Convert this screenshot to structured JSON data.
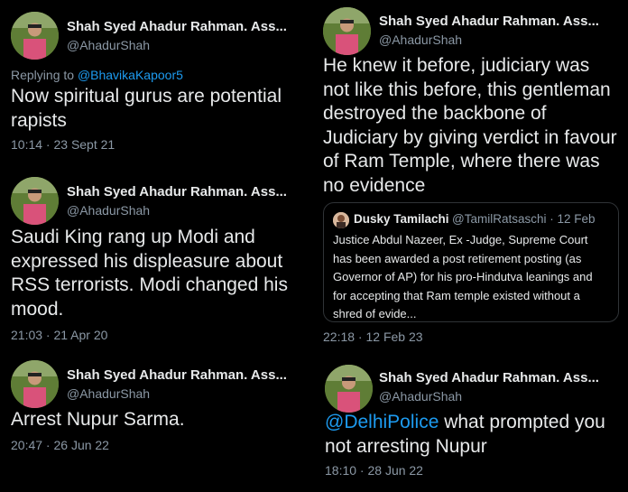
{
  "tweets": [
    {
      "name": "Shah Syed Ahadur Rahman. Ass...",
      "handle": "@AhadurShah",
      "replying_prefix": "Replying to ",
      "replying_to": "@BhavikaKapoor5",
      "text": "Now spiritual gurus are potential rapists",
      "time": "10:14 · 23 Sept 21"
    },
    {
      "name": "Shah Syed Ahadur Rahman. Ass...",
      "handle": "@AhadurShah",
      "text": "Saudi King rang up Modi and expressed his displeasure about RSS terrorists. Modi changed his mood.",
      "time": "21:03 · 21 Apr 20"
    },
    {
      "name": "Shah Syed Ahadur Rahman. Ass...",
      "handle": "@AhadurShah",
      "text": "Arrest Nupur Sarma.",
      "time": "20:47 · 26 Jun 22"
    },
    {
      "name": "Shah Syed Ahadur Rahman. Ass...",
      "handle": "@AhadurShah",
      "text": "He knew it before, judiciary was not like this before, this gentleman destroyed the backbone of Judiciary by giving verdict in favour of Ram Temple, where there was no evidence",
      "quote": {
        "name": "Dusky Tamilachi",
        "handle": "@TamilRatsaschi",
        "date": "· 12 Feb",
        "text": "Justice Abdul Nazeer, Ex -Judge, Supreme Court has been awarded a post retirement posting (as Governor of AP) for his pro-Hindutva leanings and for accepting that Ram temple existed without a shred of evide..."
      },
      "time": "22:18 · 12 Feb 23"
    },
    {
      "name": "Shah Syed Ahadur Rahman. Ass...",
      "handle": "@AhadurShah",
      "mention": "@DelhiPolice",
      "text": " what prompted you not arresting Nupur",
      "time": "18:10 · 28 Jun 22"
    }
  ],
  "colors": {
    "background": "#000000",
    "text": "#e7e9ea",
    "secondary": "#8b98a5",
    "link": "#1d9bf0",
    "divider": "#2f3336"
  }
}
